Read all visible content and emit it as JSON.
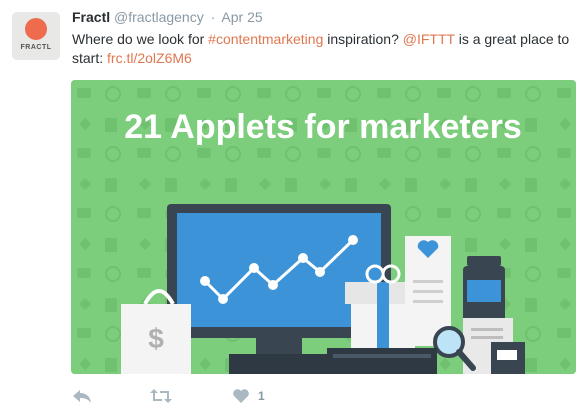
{
  "tweet": {
    "avatar_label": "FRACTL",
    "author_name": "Fractl",
    "author_handle": "@fractlagency",
    "separator": "·",
    "date": "Apr 25",
    "text_part1": "Where do we look for ",
    "hashtag": "#contentmarketing",
    "text_part2": " inspiration? ",
    "mention": "@IFTTT",
    "text_part3": " is a great place to start: ",
    "link": "frc.tl/2olZ6M6"
  },
  "media": {
    "headline": "21 Applets for marketers",
    "bag_symbol": "$"
  },
  "actions": {
    "like_count": "1"
  },
  "colors": {
    "link": "#e0774f",
    "media_background": "#7ccd7c",
    "muted_text": "#8899a6"
  }
}
